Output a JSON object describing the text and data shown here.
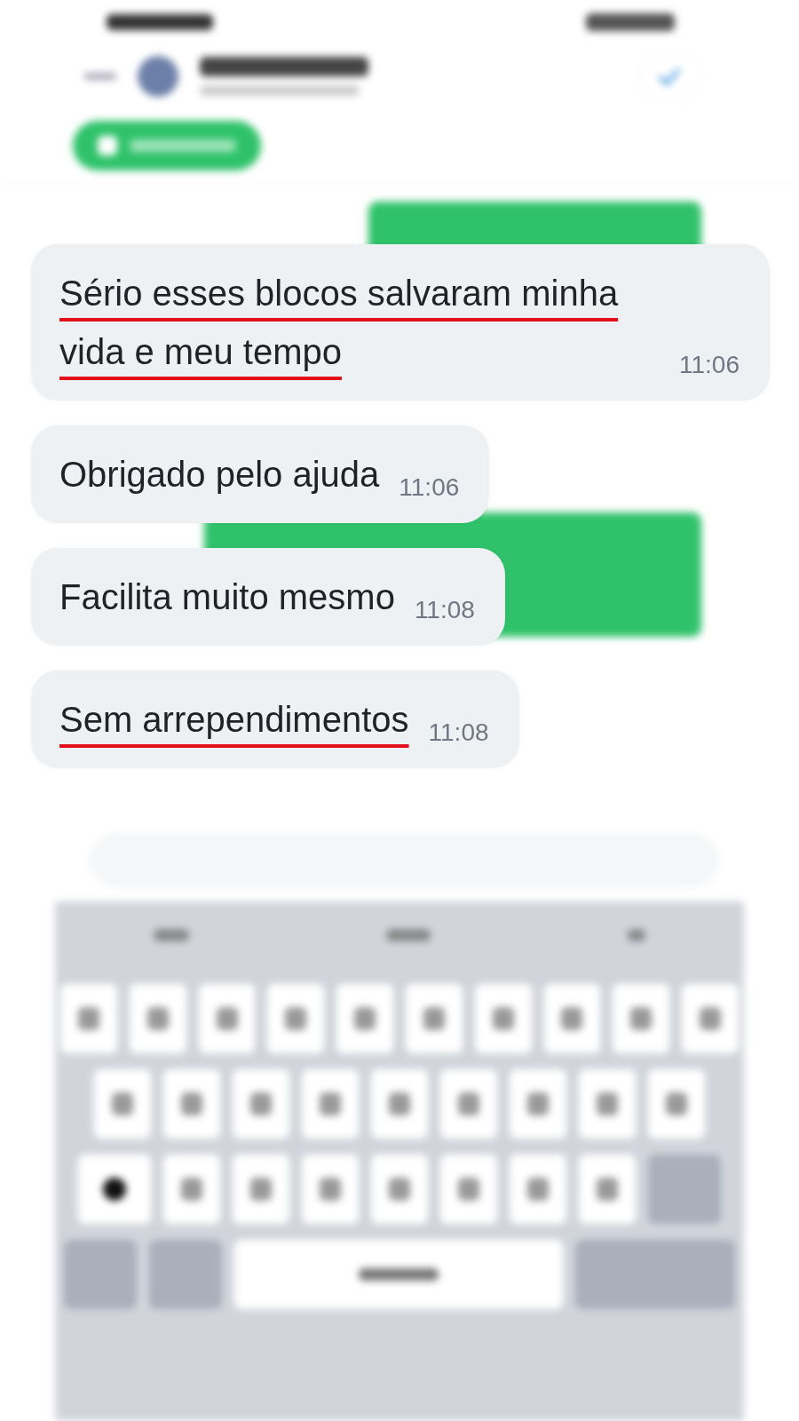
{
  "messages": [
    {
      "text": "Sério esses blocos salvaram minha vida e meu tempo",
      "time": "11:06",
      "underlined": true
    },
    {
      "text": "Obrigado pelo ajuda",
      "time": "11:06",
      "underlined": false
    },
    {
      "text": "Facilita muito mesmo",
      "time": "11:08",
      "underlined": false
    },
    {
      "text": "Sem arrependimentos",
      "time": "11:08",
      "underlined": true
    }
  ]
}
